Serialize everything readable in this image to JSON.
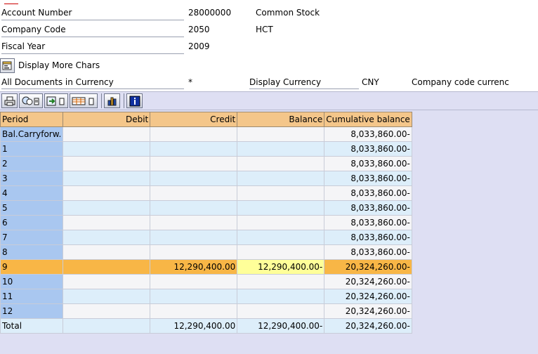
{
  "header": {
    "account_label": "Account Number",
    "account_value": "28000000",
    "account_desc": "Common Stock",
    "company_label": "Company Code",
    "company_value": "2050",
    "company_desc": "HCT",
    "year_label": "Fiscal Year",
    "year_value": "2009",
    "more_chars_label": "Display More Chars",
    "docs_label": "All Documents in Currency",
    "docs_value": "*",
    "display_currency_label": "Display Currency",
    "display_currency_value": "CNY",
    "company_code_currency": "Company code currenc"
  },
  "toolbar": {
    "icons": [
      "print-icon",
      "find-icon",
      "export-icon",
      "layout-icon",
      "chart-icon",
      "info-icon"
    ]
  },
  "table": {
    "columns": [
      "Period",
      "Debit",
      "Credit",
      "Balance",
      "Cumulative balance"
    ],
    "rows": [
      {
        "period": "Bal.Carryforw.",
        "debit": "",
        "credit": "",
        "balance": "",
        "cumulative": "8,033,860.00-"
      },
      {
        "period": "1",
        "debit": "",
        "credit": "",
        "balance": "",
        "cumulative": "8,033,860.00-"
      },
      {
        "period": "2",
        "debit": "",
        "credit": "",
        "balance": "",
        "cumulative": "8,033,860.00-"
      },
      {
        "period": "3",
        "debit": "",
        "credit": "",
        "balance": "",
        "cumulative": "8,033,860.00-"
      },
      {
        "period": "4",
        "debit": "",
        "credit": "",
        "balance": "",
        "cumulative": "8,033,860.00-"
      },
      {
        "period": "5",
        "debit": "",
        "credit": "",
        "balance": "",
        "cumulative": "8,033,860.00-"
      },
      {
        "period": "6",
        "debit": "",
        "credit": "",
        "balance": "",
        "cumulative": "8,033,860.00-"
      },
      {
        "period": "7",
        "debit": "",
        "credit": "",
        "balance": "",
        "cumulative": "8,033,860.00-"
      },
      {
        "period": "8",
        "debit": "",
        "credit": "",
        "balance": "",
        "cumulative": "8,033,860.00-"
      },
      {
        "period": "9",
        "debit": "",
        "credit": "12,290,400.00",
        "balance": "12,290,400.00-",
        "cumulative": "20,324,260.00-"
      },
      {
        "period": "10",
        "debit": "",
        "credit": "",
        "balance": "",
        "cumulative": "20,324,260.00-"
      },
      {
        "period": "11",
        "debit": "",
        "credit": "",
        "balance": "",
        "cumulative": "20,324,260.00-"
      },
      {
        "period": "12",
        "debit": "",
        "credit": "",
        "balance": "",
        "cumulative": "20,324,260.00-"
      },
      {
        "period": "Total",
        "debit": "",
        "credit": "12,290,400.00",
        "balance": "12,290,400.00-",
        "cumulative": "20,324,260.00-"
      }
    ],
    "selected_period": "9"
  }
}
